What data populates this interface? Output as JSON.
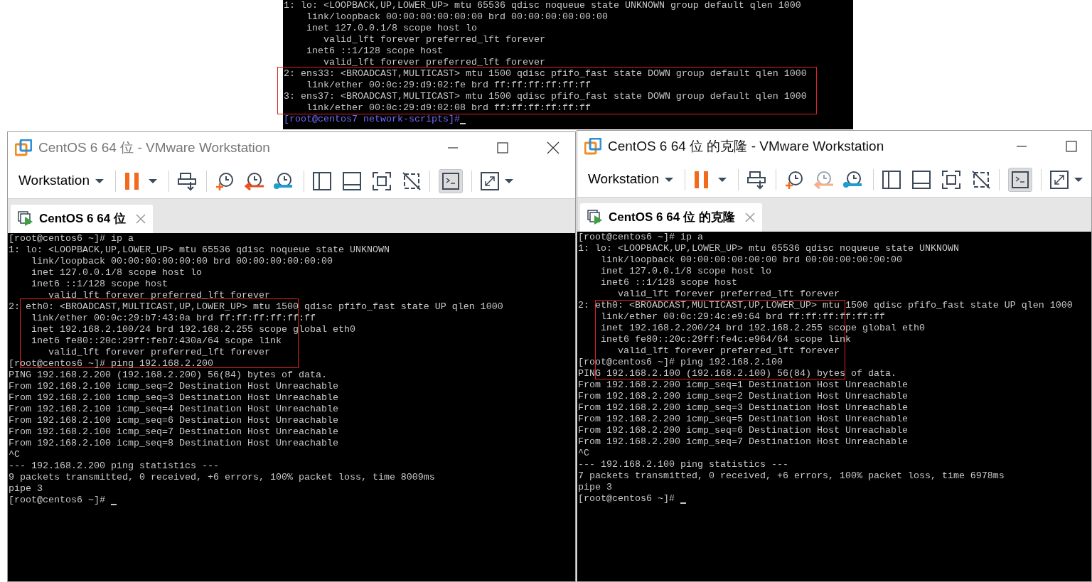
{
  "top_terminal": {
    "lines": [
      "1: lo: <LOOPBACK,UP,LOWER_UP> mtu 65536 qdisc noqueue state UNKNOWN group default qlen 1000",
      "    link/loopback 00:00:00:00:00:00 brd 00:00:00:00:00:00",
      "    inet 127.0.0.1/8 scope host lo",
      "       valid_lft forever preferred_lft forever",
      "    inet6 ::1/128 scope host",
      "       valid_lft forever preferred_lft forever",
      "2: ens33: <BROADCAST,MULTICAST> mtu 1500 qdisc pfifo_fast state DOWN group default qlen 1000",
      "    link/ether 00:0c:29:d9:02:fe brd ff:ff:ff:ff:ff:ff",
      "3: ens37: <BROADCAST,MULTICAST> mtu 1500 qdisc pfifo_fast state DOWN group default qlen 1000",
      "    link/ether 00:0c:29:d9:02:08 brd ff:ff:ff:ff:ff:ff"
    ],
    "prompt": "[root@centos7 network-scripts]#"
  },
  "windows": [
    {
      "title": "CentOS 6 64 位 - VMware Workstation",
      "active": false,
      "menu": "Workstation",
      "revert_disabled": false,
      "console_selected": true,
      "tab": {
        "label": "CentOS 6 64 位",
        "selected": true
      },
      "terminal": [
        "[root@centos6 ~]# ip a",
        "1: lo: <LOOPBACK,UP,LOWER_UP> mtu 65536 qdisc noqueue state UNKNOWN",
        "    link/loopback 00:00:00:00:00:00 brd 00:00:00:00:00:00",
        "    inet 127.0.0.1/8 scope host lo",
        "    inet6 ::1/128 scope host",
        "       valid_lft forever preferred_lft forever",
        "2: eth0: <BROADCAST,MULTICAST,UP,LOWER_UP> mtu 1500 qdisc pfifo_fast state UP qlen 1000",
        "    link/ether 00:0c:29:b7:43:0a brd ff:ff:ff:ff:ff:ff",
        "    inet 192.168.2.100/24 brd 192.168.2.255 scope global eth0",
        "    inet6 fe80::20c:29ff:feb7:430a/64 scope link",
        "       valid_lft forever preferred_lft forever",
        "[root@centos6 ~]# ping 192.168.2.200",
        "PING 192.168.2.200 (192.168.2.200) 56(84) bytes of data.",
        "From 192.168.2.100 icmp_seq=2 Destination Host Unreachable",
        "From 192.168.2.100 icmp_seq=3 Destination Host Unreachable",
        "From 192.168.2.100 icmp_seq=4 Destination Host Unreachable",
        "From 192.168.2.100 icmp_seq=6 Destination Host Unreachable",
        "From 192.168.2.100 icmp_seq=7 Destination Host Unreachable",
        "From 192.168.2.100 icmp_seq=8 Destination Host Unreachable",
        "^C",
        "--- 192.168.2.200 ping statistics ---",
        "9 packets transmitted, 0 received, +6 errors, 100% packet loss, time 8009ms",
        "pipe 3",
        "[root@centos6 ~]#"
      ]
    },
    {
      "title": "CentOS 6 64 位 的克隆 - VMware Workstation",
      "active": true,
      "menu": "Workstation",
      "revert_disabled": true,
      "console_selected": true,
      "tab": {
        "label": "CentOS 6 64 位 的克隆",
        "selected": true
      },
      "terminal": [
        "[root@centos6 ~]# ip a",
        "1: lo: <LOOPBACK,UP,LOWER_UP> mtu 65536 qdisc noqueue state UNKNOWN",
        "    link/loopback 00:00:00:00:00:00 brd 00:00:00:00:00:00",
        "    inet 127.0.0.1/8 scope host lo",
        "    inet6 ::1/128 scope host",
        "       valid_lft forever preferred_lft forever",
        "2: eth0: <BROADCAST,MULTICAST,UP,LOWER_UP> mtu 1500 qdisc pfifo_fast state UP qlen 1000",
        "    link/ether 00:0c:29:4c:e9:64 brd ff:ff:ff:ff:ff:ff",
        "    inet 192.168.2.200/24 brd 192.168.2.255 scope global eth0",
        "    inet6 fe80::20c:29ff:fe4c:e964/64 scope link",
        "       valid_lft forever preferred_lft forever",
        "[root@centos6 ~]# ping 192.168.2.100",
        "PING 192.168.2.100 (192.168.2.100) 56(84) bytes of data.",
        "From 192.168.2.200 icmp_seq=1 Destination Host Unreachable",
        "From 192.168.2.200 icmp_seq=2 Destination Host Unreachable",
        "From 192.168.2.200 icmp_seq=3 Destination Host Unreachable",
        "From 192.168.2.200 icmp_seq=5 Destination Host Unreachable",
        "From 192.168.2.200 icmp_seq=6 Destination Host Unreachable",
        "From 192.168.2.200 icmp_seq=7 Destination Host Unreachable",
        "^C",
        "--- 192.168.2.100 ping statistics ---",
        "7 packets transmitted, 0 received, +6 errors, 100% packet loss, time 6978ms",
        "pipe 3",
        "[root@centos6 ~]#"
      ]
    }
  ]
}
